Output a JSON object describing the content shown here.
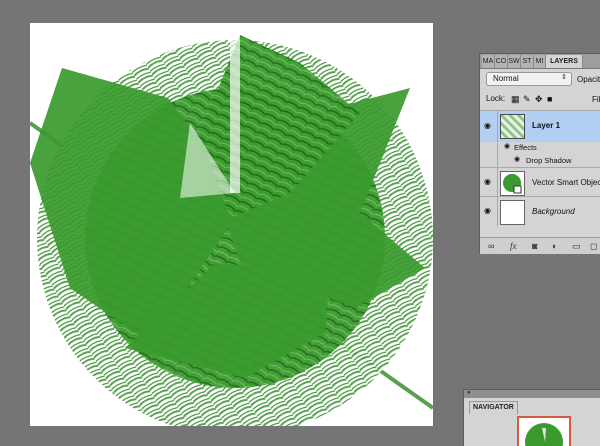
{
  "canvas": {
    "background": "#ffffff",
    "artwork_color": "#3a9a2e"
  },
  "layers_panel": {
    "tabs": [
      "MA",
      "CO",
      "SW",
      "ST",
      "MI",
      "LAYERS"
    ],
    "active_tab": "LAYERS",
    "blend_mode": "Normal",
    "opacity_label": "Opacity",
    "lock_label": "Lock:",
    "fill_label": "Fill",
    "layers": [
      {
        "name": "Layer 1",
        "selected": true,
        "italic": false
      },
      {
        "name": "Vector Smart Object",
        "selected": false,
        "italic": false
      },
      {
        "name": "Background",
        "selected": false,
        "italic": true
      }
    ],
    "effects_label": "Effects",
    "drop_shadow_label": "Drop Shadow",
    "selection_color": "#b3cff2"
  },
  "navigator": {
    "tab_label": "NAVIGATOR",
    "view_box_color": "#d65a43"
  }
}
